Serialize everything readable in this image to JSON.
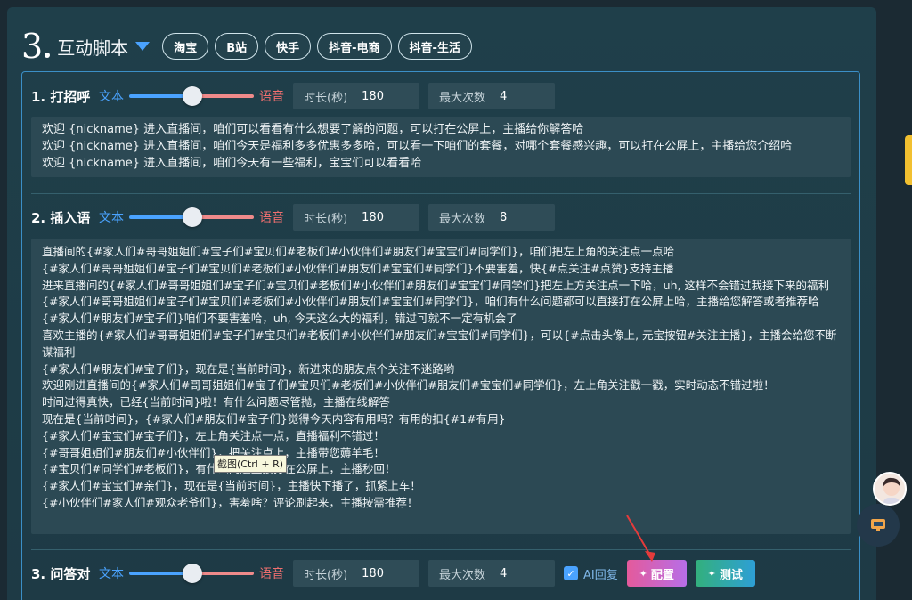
{
  "section": {
    "number": "3",
    "title": "互动脚本"
  },
  "platform_tabs": [
    "淘宝",
    "B站",
    "快手",
    "抖音-电商",
    "抖音-生活"
  ],
  "modes": {
    "text": "文本",
    "voice": "语音"
  },
  "fields": {
    "duration_label": "时长(秒)",
    "max_label": "最大次数"
  },
  "rows": [
    {
      "title": "1. 打招呼",
      "duration": "180",
      "max": "4",
      "lines": [
        "欢迎 {nickname} 进入直播间，咱们可以看看有什么想要了解的问题，可以打在公屏上，主播给你解答哈",
        "欢迎 {nickname} 进入直播间，咱们今天是福利多多优惠多多哈，可以看一下咱们的套餐，对哪个套餐感兴趣，可以打在公屏上，主播给您介绍哈",
        "欢迎 {nickname} 进入直播间，咱们今天有一些福利，宝宝们可以看看哈"
      ]
    },
    {
      "title": "2. 插入语",
      "duration": "180",
      "max": "8",
      "lines": [
        "直播间的{#家人们#哥哥姐姐们#宝子们#宝贝们#老板们#小伙伴们#朋友们#宝宝们#同学们}，咱们把左上角的关注点一点哈",
        "{#家人们#哥哥姐姐们#宝子们#宝贝们#老板们#小伙伴们#朋友们#宝宝们#同学们}不要害羞，快{#点关注#点赞}支持主播",
        "进来直播间的{#家人们#哥哥姐姐们#宝子们#宝贝们#老板们#小伙伴们#朋友们#宝宝们#同学们}把左上方关注点一下哈，uh, 这样不会错过我接下来的福利",
        "{#家人们#哥哥姐姐们#宝子们#宝贝们#老板们#小伙伴们#朋友们#宝宝们#同学们}，咱们有什么问题都可以直接打在公屏上哈，主播给您解答或者推荐哈",
        "{#家人们#朋友们#宝子们}咱们不要害羞哈，uh, 今天这么大的福利，错过可就不一定有机会了",
        "喜欢主播的{#家人们#哥哥姐姐们#宝子们#宝贝们#老板们#小伙伴们#朋友们#宝宝们#同学们}，可以{#点击头像上, 元宝按钮#关注主播}，主播会给您不断谋福利",
        "{#家人们#朋友们#宝子们}，现在是{当前时间}，新进来的朋友点个关注不迷路哟",
        "欢迎刚进直播间的{#家人们#哥哥姐姐们#宝子们#宝贝们#老板们#小伙伴们#朋友们#宝宝们#同学们}，左上角关注戳一戳，实时动态不错过啦！",
        "时间过得真快，已经{当前时间}啦！有什么问题尽管抛，主播在线解答",
        "现在是{当前时间}，{#家人们#朋友们#宝子们}觉得今天内容有用吗？有用的扣{#1#有用}",
        "{#家人们#宝宝们#宝子们}，左上角关注点一点，直播福利不错过！",
        "{#哥哥姐姐们#朋友们#小伙伴们}，把关注点上，主播带您薅羊毛！",
        "{#宝贝们#同学们#老板们}，有什么问题直接打在公屏上，主播秒回！",
        "{#家人们#宝宝们#亲们}，现在是{当前时间}，主播快下播了，抓紧上车！",
        "{#小伙伴们#家人们#观众老爷们}，害羞啥？评论刷起来，主播按需推荐！"
      ]
    },
    {
      "title": "3. 问答对",
      "duration": "180",
      "max": "4",
      "ai_reply_label": "AI回复",
      "config_label": "配置",
      "test_label": "测试"
    }
  ],
  "tooltip": "截图(Ctrl + R)",
  "colors": {
    "accent": "#4aa3ff",
    "voice": "#ef6f6f",
    "config_btn": "#e45a9b",
    "test_btn": "#33b07c"
  }
}
